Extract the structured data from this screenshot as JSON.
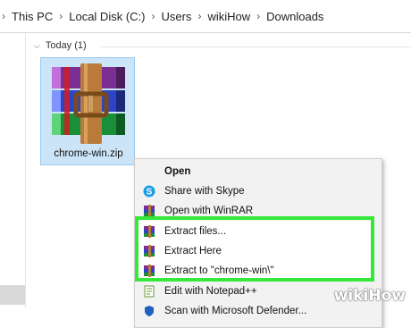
{
  "address_bar": {
    "crumbs": [
      "This PC",
      "Local Disk (C:)",
      "Users",
      "wikiHow",
      "Downloads"
    ]
  },
  "group": {
    "label": "Today (1)"
  },
  "file": {
    "name": "chrome-win.zip"
  },
  "context_menu": {
    "items": [
      {
        "label": "Open",
        "icon": "none",
        "bold": true
      },
      {
        "label": "Share with Skype",
        "icon": "skype-icon"
      },
      {
        "label": "Open with WinRAR",
        "icon": "winrar-icon"
      },
      {
        "label": "Extract files...",
        "icon": "winrar-icon"
      },
      {
        "label": "Extract Here",
        "icon": "winrar-icon"
      },
      {
        "label": "Extract to \"chrome-win\\\"",
        "icon": "winrar-icon"
      },
      {
        "label": "Edit with Notepad++",
        "icon": "notepadpp-icon"
      },
      {
        "label": "Scan with Microsoft Defender...",
        "icon": "defender-icon"
      }
    ]
  },
  "colors": {
    "highlight": "#35e83a",
    "selection": "#cce4f7"
  },
  "watermark": {
    "text": "wikiHow"
  }
}
